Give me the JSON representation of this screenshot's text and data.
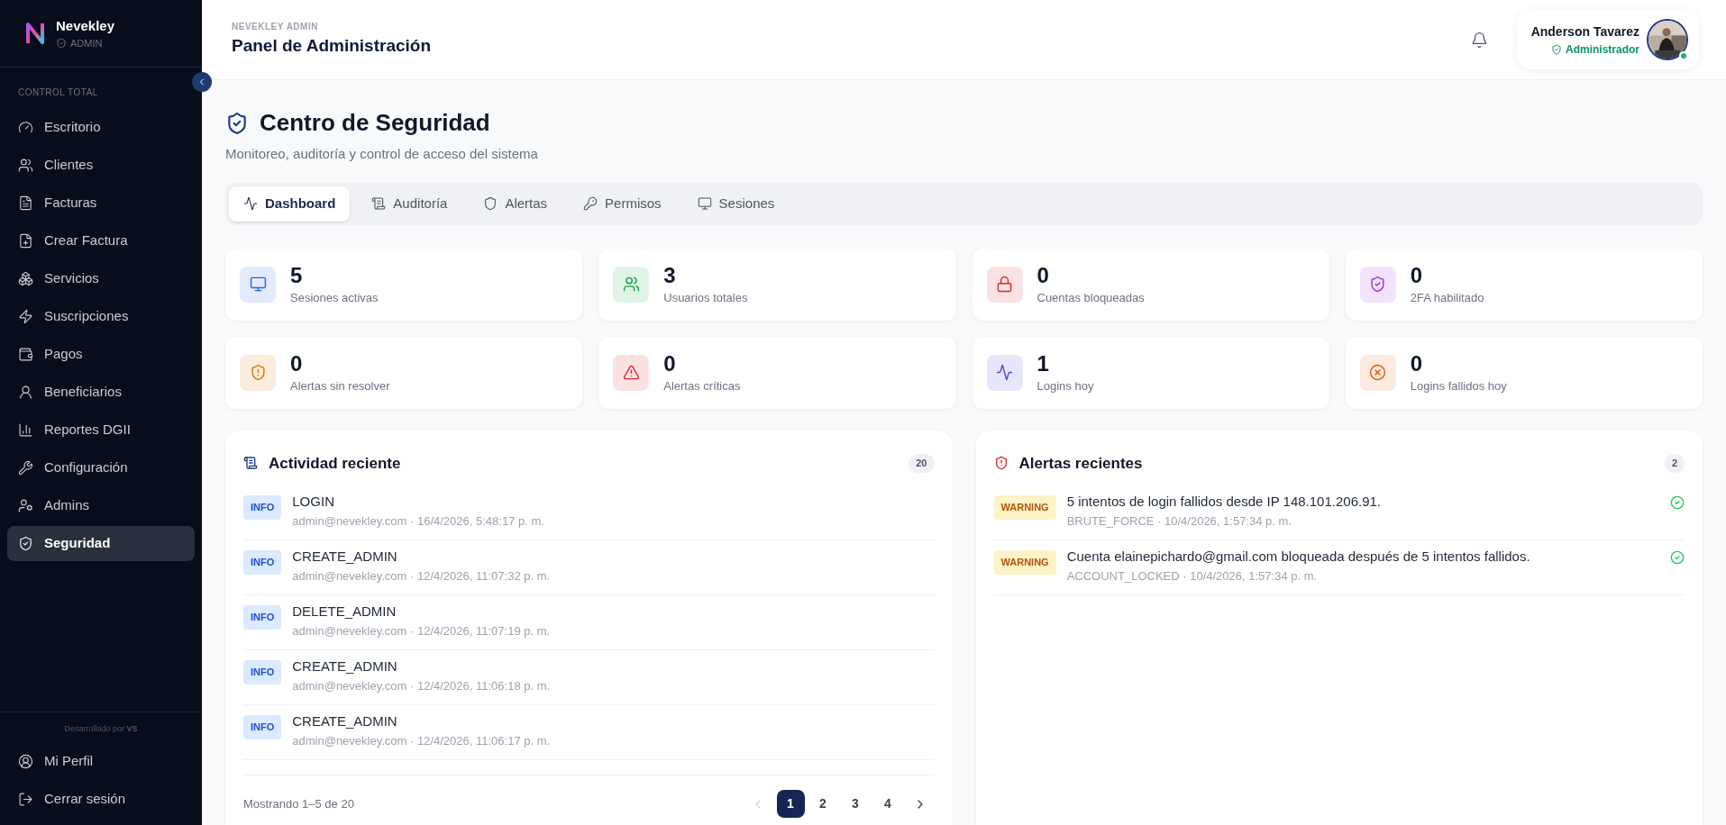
{
  "brand": {
    "name": "Nevekley",
    "role": "ADMIN"
  },
  "sidebar": {
    "section": "CONTROL TOTAL",
    "items": [
      {
        "label": "Escritorio",
        "selected": false
      },
      {
        "label": "Clientes",
        "selected": false
      },
      {
        "label": "Facturas",
        "selected": false
      },
      {
        "label": "Crear Factura",
        "selected": false
      },
      {
        "label": "Servicios",
        "selected": false
      },
      {
        "label": "Suscripciones",
        "selected": false
      },
      {
        "label": "Pagos",
        "selected": false
      },
      {
        "label": "Beneficiarios",
        "selected": false
      },
      {
        "label": "Reportes DGII",
        "selected": false
      },
      {
        "label": "Configuración",
        "selected": false
      },
      {
        "label": "Admins",
        "selected": false
      },
      {
        "label": "Seguridad",
        "selected": true
      }
    ],
    "credit": "Desarrollado por **VS**",
    "footer": [
      "Mi Perfil",
      "Cerrar sesión"
    ]
  },
  "header": {
    "eyebrow": "NEVEKLEY ADMIN",
    "title": "Panel de Administración",
    "user": {
      "name": "Anderson Tavarez",
      "role": "Administrador",
      "online": true
    }
  },
  "page": {
    "title": "Centro de Seguridad",
    "subtitle": "Monitoreo, auditoría y control de acceso del sistema"
  },
  "tabs": [
    {
      "label": "Dashboard",
      "selected": true
    },
    {
      "label": "Auditoría",
      "selected": false
    },
    {
      "label": "Alertas",
      "selected": false
    },
    {
      "label": "Permisos",
      "selected": false
    },
    {
      "label": "Sesiones",
      "selected": false
    }
  ],
  "stats": [
    {
      "value": "5",
      "label": "Sesiones activas",
      "color": "#2563eb"
    },
    {
      "value": "3",
      "label": "Usuarios totales",
      "color": "#16a34a"
    },
    {
      "value": "0",
      "label": "Cuentas bloqueadas",
      "color": "#dc2626"
    },
    {
      "value": "0",
      "label": "2FA habilitado",
      "color": "#9333ea"
    },
    {
      "value": "0",
      "label": "Alertas sin resolver",
      "color": "#d97706"
    },
    {
      "value": "0",
      "label": "Alertas críticas",
      "color": "#dc2626"
    },
    {
      "value": "1",
      "label": "Logins hoy",
      "color": "#4f46e5"
    },
    {
      "value": "0",
      "label": "Logins fallidos hoy",
      "color": "#ea580c"
    }
  ],
  "activity": {
    "title": "Actividad reciente",
    "count": "20",
    "rows": [
      {
        "level": "INFO",
        "action": "LOGIN",
        "meta": "admin@nevekley.com · 16/4/2026, 5:48:17 p. m."
      },
      {
        "level": "INFO",
        "action": "CREATE_ADMIN",
        "meta": "admin@nevekley.com · 12/4/2026, 11:07:32 p. m."
      },
      {
        "level": "INFO",
        "action": "DELETE_ADMIN",
        "meta": "admin@nevekley.com · 12/4/2026, 11:07:19 p. m."
      },
      {
        "level": "INFO",
        "action": "CREATE_ADMIN",
        "meta": "admin@nevekley.com · 12/4/2026, 11:06:18 p. m."
      },
      {
        "level": "INFO",
        "action": "CREATE_ADMIN",
        "meta": "admin@nevekley.com · 12/4/2026, 11:06:17 p. m."
      }
    ],
    "showing": "Mostrando 1–5 de 20",
    "pagination": {
      "prev_disabled": true,
      "pages": [
        {
          "label": "1",
          "selected": true
        },
        {
          "label": "2",
          "selected": false
        },
        {
          "label": "3",
          "selected": false
        },
        {
          "label": "4",
          "selected": false
        }
      ]
    }
  },
  "alerts": {
    "title": "Alertas recientes",
    "count": "2",
    "rows": [
      {
        "level": "WARNING",
        "message": "5 intentos de login fallidos desde IP 148.101.206.91.",
        "meta": "BRUTE_FORCE · 10/4/2026, 1:57:34 p. m.",
        "resolved": true
      },
      {
        "level": "WARNING",
        "message": "Cuenta elainepichardo@gmail.com bloqueada después de 5 intentos fallidos.",
        "meta": "ACCOUNT_LOCKED · 10/4/2026, 1:57:34 p. m.",
        "resolved": true
      }
    ]
  }
}
